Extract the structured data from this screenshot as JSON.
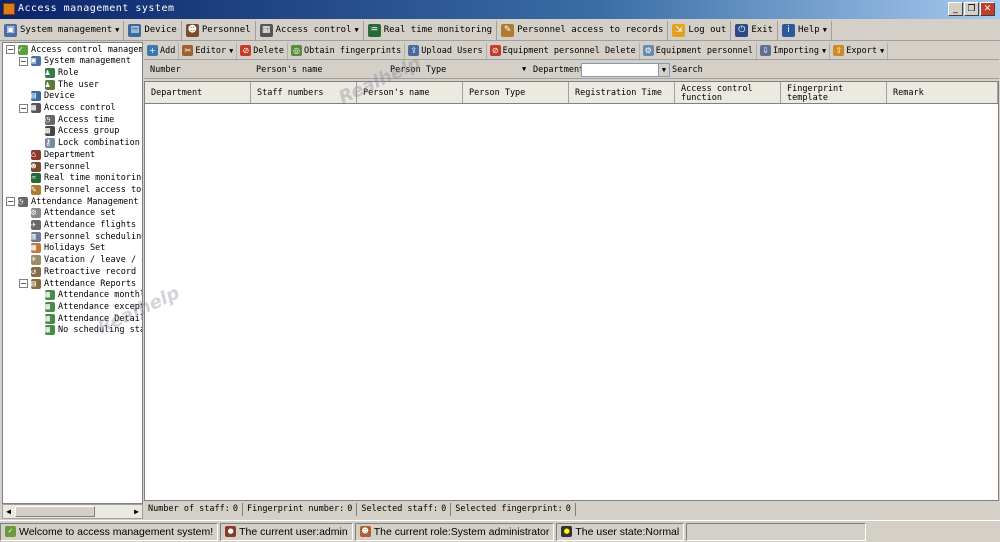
{
  "window": {
    "title": "Access management system",
    "controls": [
      "minimize-icon",
      "restore-icon",
      "close-icon"
    ]
  },
  "menubar": [
    {
      "label": "System management",
      "icon": "computer-icon",
      "dropdown": true
    },
    {
      "label": "Device",
      "icon": "device-icon",
      "dropdown": false
    },
    {
      "label": "Personnel",
      "icon": "person-icon",
      "dropdown": false
    },
    {
      "label": "Access control",
      "icon": "access-icon",
      "dropdown": true
    },
    {
      "label": "Real time monitoring",
      "icon": "monitor-icon",
      "dropdown": false
    },
    {
      "label": "Personnel access to records",
      "icon": "records-icon",
      "dropdown": false
    },
    {
      "label": "Log out",
      "icon": "logout-icon",
      "dropdown": false
    },
    {
      "label": "Exit",
      "icon": "power-icon",
      "dropdown": false
    },
    {
      "label": "Help",
      "icon": "help-icon",
      "dropdown": true
    }
  ],
  "tree": [
    {
      "label": "Access control management",
      "level": 0,
      "expander": "-",
      "icon": "checkbox-icon"
    },
    {
      "label": "System management",
      "level": 1,
      "expander": "-",
      "icon": "computer-icon"
    },
    {
      "label": "Role",
      "level": 2,
      "expander": "",
      "icon": "role-icon"
    },
    {
      "label": "The user",
      "level": 2,
      "expander": "",
      "icon": "user-icon"
    },
    {
      "label": "Device",
      "level": 1,
      "expander": "",
      "icon": "device-icon"
    },
    {
      "label": "Access control",
      "level": 1,
      "expander": "-",
      "icon": "access-icon"
    },
    {
      "label": "Access time",
      "level": 2,
      "expander": "",
      "icon": "clock-icon"
    },
    {
      "label": "Access group",
      "level": 2,
      "expander": "",
      "icon": "group-icon"
    },
    {
      "label": "Lock combination",
      "level": 2,
      "expander": "",
      "icon": "key-icon"
    },
    {
      "label": "Department",
      "level": 1,
      "expander": "",
      "icon": "department-icon"
    },
    {
      "label": "Personnel",
      "level": 1,
      "expander": "",
      "icon": "person-icon"
    },
    {
      "label": "Real time monitoring",
      "level": 1,
      "expander": "",
      "icon": "monitor-icon"
    },
    {
      "label": "Personnel access to re",
      "level": 1,
      "expander": "",
      "icon": "records-icon"
    },
    {
      "label": "Attendance Management",
      "level": 0,
      "expander": "-",
      "icon": "clock-icon"
    },
    {
      "label": "Attendance set",
      "level": 1,
      "expander": "",
      "icon": "settings-icon"
    },
    {
      "label": "Attendance flights",
      "level": 1,
      "expander": "",
      "icon": "flight-icon"
    },
    {
      "label": "Personnel scheduling",
      "level": 1,
      "expander": "",
      "icon": "schedule-icon"
    },
    {
      "label": "Holidays Set",
      "level": 1,
      "expander": "",
      "icon": "calendar-icon"
    },
    {
      "label": "Vacation / leave / ove",
      "level": 1,
      "expander": "",
      "icon": "vacation-icon"
    },
    {
      "label": "Retroactive record",
      "level": 1,
      "expander": "",
      "icon": "retro-icon"
    },
    {
      "label": "Attendance Reports",
      "level": 1,
      "expander": "-",
      "icon": "report-icon"
    },
    {
      "label": "Attendance monthly",
      "level": 2,
      "expander": "",
      "icon": "sheet-icon"
    },
    {
      "label": "Attendance exceptio",
      "level": 2,
      "expander": "",
      "icon": "sheet-icon"
    },
    {
      "label": "Attendance Detail",
      "level": 2,
      "expander": "",
      "icon": "sheet-icon"
    },
    {
      "label": "No scheduling stati",
      "level": 2,
      "expander": "",
      "icon": "sheet-icon"
    }
  ],
  "toolbar": [
    {
      "label": "Add",
      "icon": "add-icon",
      "dropdown": false
    },
    {
      "label": "Editor",
      "icon": "edit-icon",
      "dropdown": true
    },
    {
      "label": "Delete",
      "icon": "delete-icon",
      "dropdown": false
    },
    {
      "label": "Obtain fingerprints",
      "icon": "fingerprint-icon",
      "dropdown": false
    },
    {
      "label": "Upload Users",
      "icon": "upload-icon",
      "dropdown": false
    },
    {
      "label": "Equipment personnel Delete",
      "icon": "delete-icon",
      "dropdown": false
    },
    {
      "label": "Equipment personnel",
      "icon": "equipment-icon",
      "dropdown": false
    },
    {
      "label": "Importing",
      "icon": "import-icon",
      "dropdown": true
    },
    {
      "label": "Export",
      "icon": "export-icon",
      "dropdown": true
    }
  ],
  "search": {
    "number_label": "Number",
    "name_label": "Person's name",
    "type_label": "Person Type",
    "department_label": "Department",
    "department_value": "",
    "search_label": "Search"
  },
  "table": {
    "columns": [
      "Department",
      "Staff numbers",
      "Person's name",
      "Person Type",
      "Registration Time",
      "Access control function",
      "Fingerprint template",
      "Remark"
    ],
    "rows": []
  },
  "counters": [
    {
      "label": "Number of staff:",
      "value": "0"
    },
    {
      "label": "Fingerprint number:",
      "value": "0"
    },
    {
      "label": "Selected staff:",
      "value": "0"
    },
    {
      "label": "Selected fingerprint:",
      "value": "0"
    }
  ],
  "statusbar": {
    "welcome": "Welcome to access management system!",
    "user": "The current user:admin",
    "role": "The current role:System administrator",
    "state": "The user state:Normal"
  },
  "watermark": "Realhelp",
  "colors": {
    "titlebar": "#0a246a",
    "window_bg": "#d4d0c8",
    "accent_red": "#c43c2a"
  }
}
